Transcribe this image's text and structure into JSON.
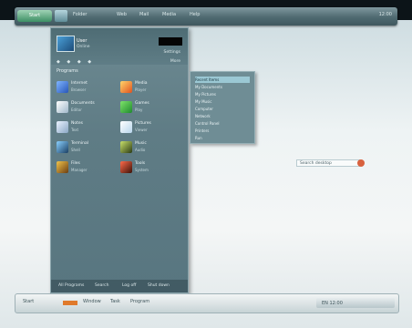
{
  "topbar": {
    "start_label": "Start",
    "items": [
      "Folder",
      "Web",
      "Mail",
      "Media",
      "Help"
    ],
    "clock": "12:00"
  },
  "start_menu": {
    "user_name": "User",
    "tag": "Online",
    "right_label": "Settings",
    "toolbar_icons": "◆ ◆ ◆ ◆",
    "sub_label": "More",
    "section_title": "Programs",
    "apps": [
      {
        "title": "Internet",
        "sub": "Browser"
      },
      {
        "title": "Media",
        "sub": "Player"
      },
      {
        "title": "Documents",
        "sub": "Editor"
      },
      {
        "title": "Games",
        "sub": "Play"
      },
      {
        "title": "Notes",
        "sub": "Text"
      },
      {
        "title": "Pictures",
        "sub": "Viewer"
      },
      {
        "title": "Terminal",
        "sub": "Shell"
      },
      {
        "title": "Music",
        "sub": "Audio"
      },
      {
        "title": "Files",
        "sub": "Manager"
      },
      {
        "title": "Tools",
        "sub": "System"
      }
    ],
    "footer": [
      "All Programs",
      "Search",
      "Log off",
      "Shut down"
    ]
  },
  "submenu": {
    "items": [
      "Recent Items",
      "My Documents",
      "My Pictures",
      "My Music",
      "Computer",
      "Network",
      "Control Panel",
      "Printers",
      "Run"
    ]
  },
  "desktop": {
    "field_text": "Search desktop"
  },
  "taskbar": {
    "items": [
      "Start",
      "Window",
      "Task",
      "Program"
    ],
    "tray_text": "EN 12:00"
  }
}
